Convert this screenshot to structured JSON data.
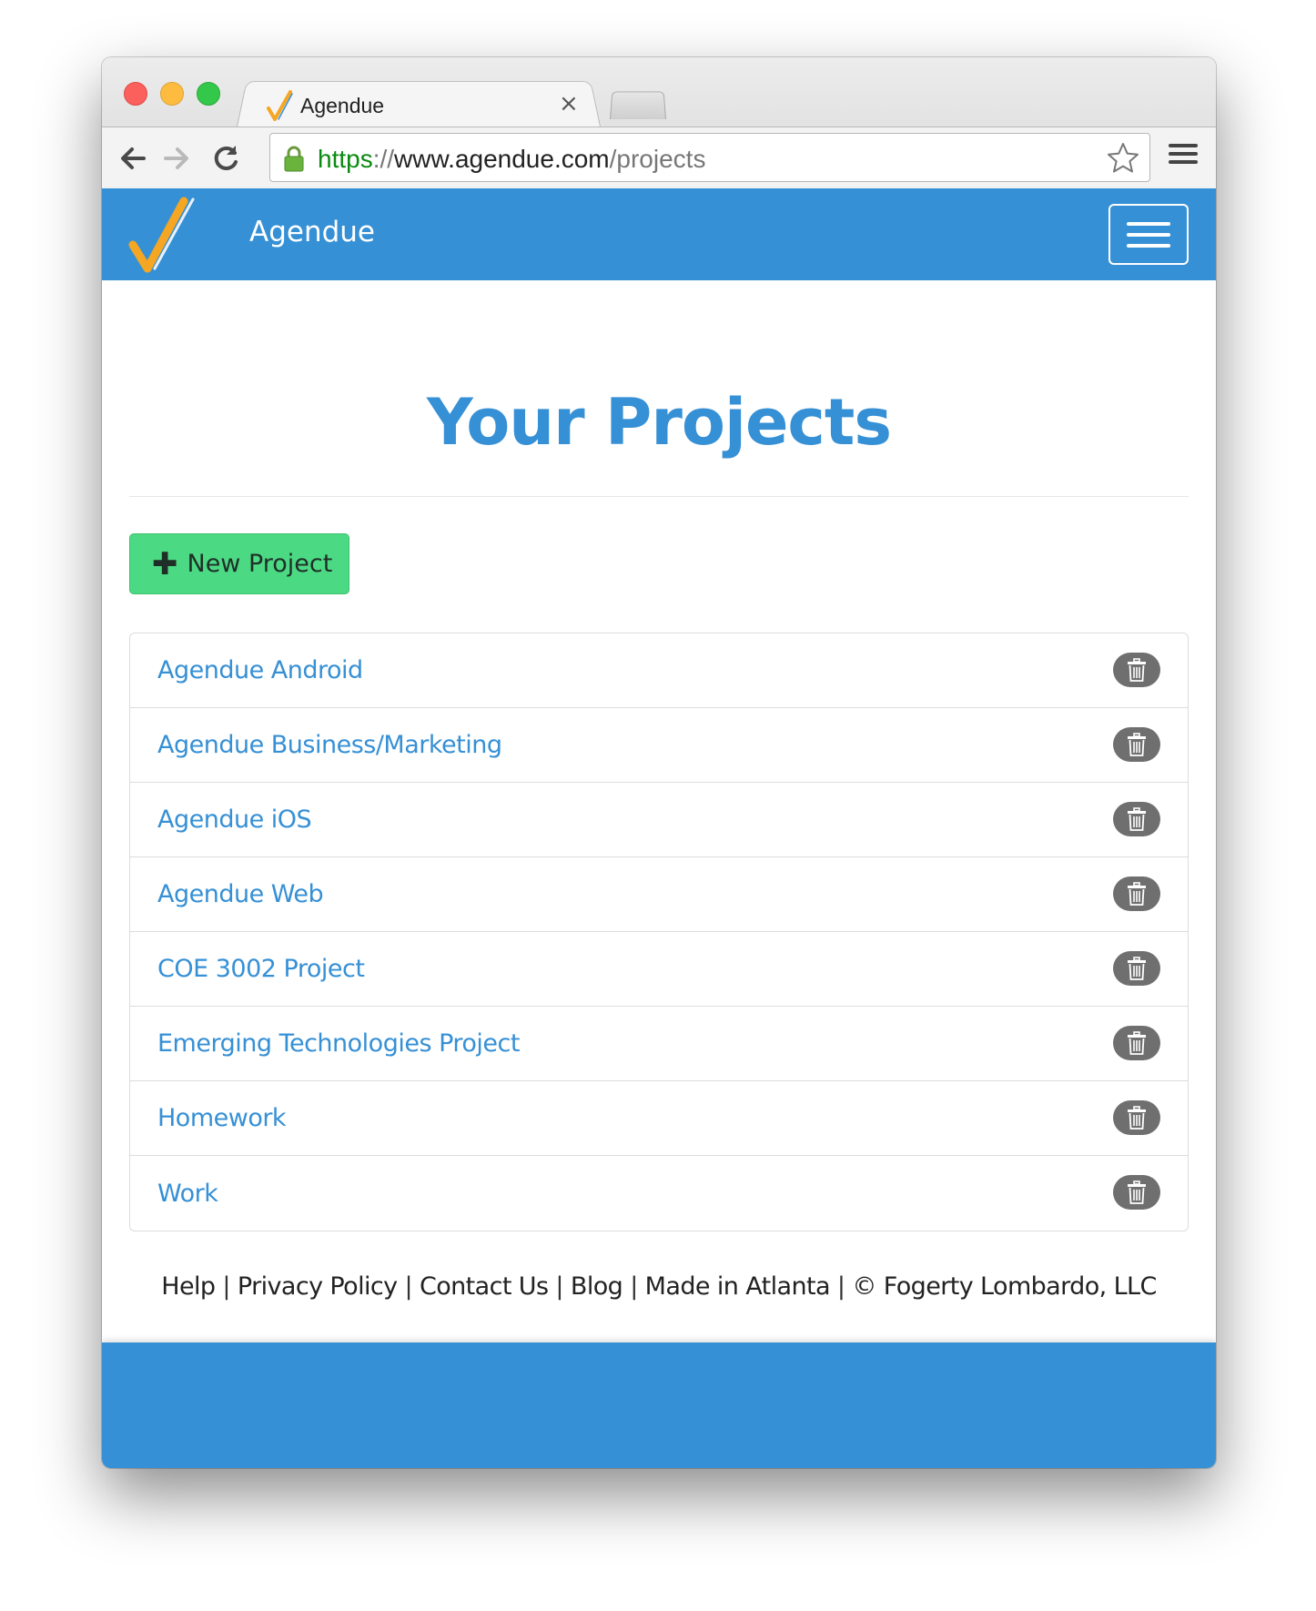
{
  "browser": {
    "tab_title": "Agendue",
    "tab_close": "×",
    "url_scheme": "https",
    "url_separator": "://",
    "url_host": "www.agendue.com",
    "url_path": "/projects"
  },
  "navbar": {
    "brand_name": "Agendue",
    "brand_color": "#3690d5",
    "logo_colors": [
      "#f5a623",
      "#ffffff"
    ]
  },
  "main": {
    "title": "Your Projects",
    "new_project_icon": "plus-icon",
    "new_project_label": "New Project",
    "new_project_color": "#4cd984",
    "projects": [
      {
        "name": "Agendue Android"
      },
      {
        "name": "Agendue Business/Marketing"
      },
      {
        "name": "Agendue iOS"
      },
      {
        "name": "Agendue Web"
      },
      {
        "name": "COE 3002 Project"
      },
      {
        "name": "Emerging Technologies Project"
      },
      {
        "name": "Homework"
      },
      {
        "name": "Work"
      }
    ],
    "delete_icon": "trash-icon"
  },
  "footer": {
    "links": [
      "Help",
      "Privacy Policy",
      "Contact Us",
      "Blog",
      "Made in Atlanta",
      "© Fogerty Lombardo, LLC"
    ],
    "separator": "|"
  }
}
